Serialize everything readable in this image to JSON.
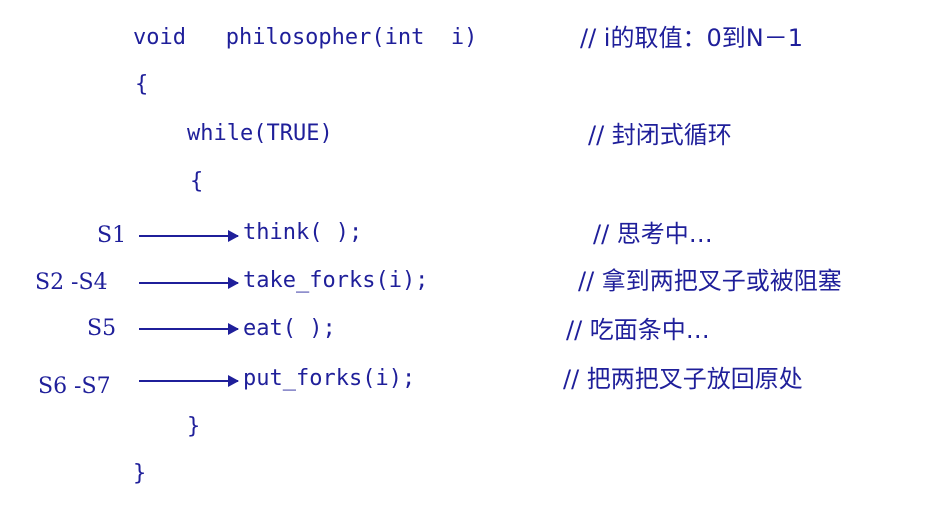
{
  "code": {
    "signature": "void   philosopher(int  i)",
    "open_brace_outer": "{",
    "while_line": "while(TRUE)",
    "open_brace_inner": "{",
    "think": "think( );",
    "take_forks": "take_forks(i);",
    "eat": "eat( );",
    "put_forks": "put_forks(i);",
    "close_brace_inner": "}",
    "close_brace_outer": "}"
  },
  "comments": {
    "signature": "// i的取值：0到N－1",
    "while": "// 封闭式循环",
    "think": "// 思考中…",
    "take_forks": "// 拿到两把叉子或被阻塞",
    "eat": "// 吃面条中…",
    "put_forks": "// 把两把叉子放回原处"
  },
  "steps": {
    "s1": "S1",
    "s2_s4": "S2 -S4",
    "s5": "S5",
    "s6_s7": "S6 -S7"
  },
  "colors": {
    "text": "#1f1f9a",
    "background": "#ffffff"
  }
}
